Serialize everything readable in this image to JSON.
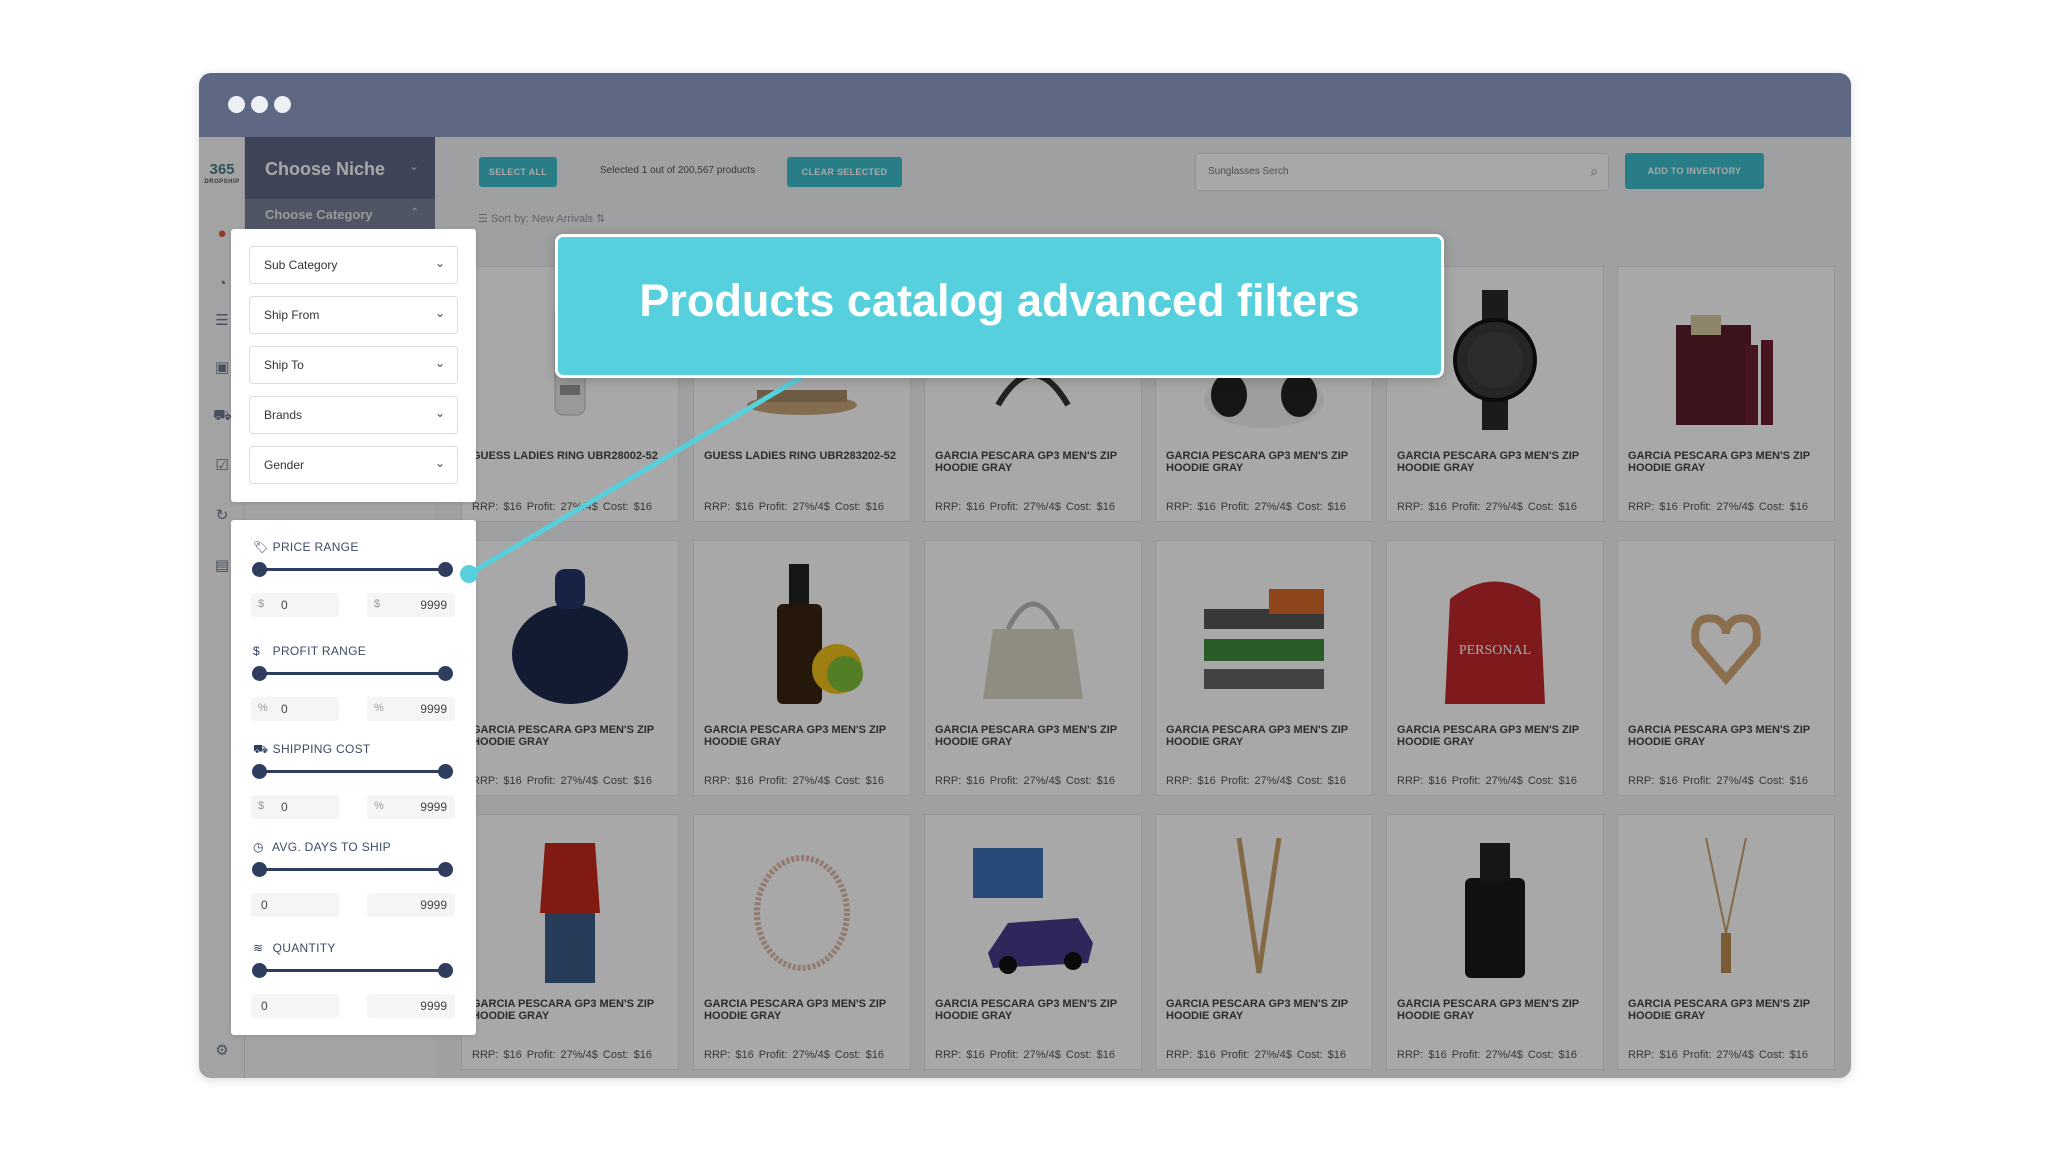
{
  "window": {
    "title_dots": 3
  },
  "logo": {
    "main": "365",
    "sub": "DROPSHIP"
  },
  "sidebar": {
    "niche_label": "Choose Niche",
    "category_label": "Choose Category",
    "dropdowns": [
      "Sub Category",
      "Ship From",
      "Ship To",
      "Brands",
      "Gender"
    ],
    "ranges": [
      {
        "label": "PRICE RANGE",
        "icon": "price-tag-icon",
        "min_symbol": "$",
        "min": "0",
        "max_symbol": "$",
        "max": "9999"
      },
      {
        "label": "PROFIT RANGE",
        "icon": "dollar-circle-icon",
        "min_symbol": "%",
        "min": "0",
        "max_symbol": "%",
        "max": "9999"
      },
      {
        "label": "SHIPPING COST",
        "icon": "truck-icon",
        "min_symbol": "$",
        "min": "0",
        "max_symbol": "%",
        "max": "9999"
      },
      {
        "label": "AVG. DAYS TO SHIP",
        "icon": "clock-icon",
        "min_symbol": "",
        "min": "0",
        "max_symbol": "",
        "max": "9999"
      },
      {
        "label": "QUANTITY",
        "icon": "layers-icon",
        "min_symbol": "",
        "min": "0",
        "max_symbol": "",
        "max": "9999"
      }
    ]
  },
  "toolbar": {
    "select_all": "SELECT ALL",
    "selected_text": "Selected  1 out of 200,567 products",
    "clear_selected": "CLEAR SELECTED",
    "search_value": "Sunglasses Serch",
    "add_to_inventory": "ADD TO INVENTORY",
    "sort_label": "Sort by: New Arrivals"
  },
  "products": [
    {
      "title": "GUESS LADIES RING UBR28002-52",
      "meta": "RRP: $16  Profit: 27%/4$  Cost: $16",
      "img": "perfume"
    },
    {
      "title": "GUESS LADIES RING UBR283202-52",
      "meta": "RRP: $16  Profit: 27%/4$  Cost: $16",
      "img": "ring"
    },
    {
      "title": "GARCIA PESCARA GP3 MEN'S ZIP HOODIE GRAY",
      "meta": "RRP: $16  Profit: 27%/4$  Cost: $16",
      "img": "headphones"
    },
    {
      "title": "GARCIA PESCARA GP3 MEN'S ZIP HOODIE GRAY",
      "meta": "RRP: $16  Profit: 27%/4$  Cost: $16",
      "img": "panda"
    },
    {
      "title": "GARCIA PESCARA GP3 MEN'S ZIP HOODIE GRAY",
      "meta": "RRP: $16  Profit: 27%/4$  Cost: $16",
      "img": "watch"
    },
    {
      "title": "GARCIA PESCARA GP3 MEN'S ZIP HOODIE GRAY",
      "meta": "RRP: $16  Profit: 27%/4$  Cost: $16",
      "img": "gift-box"
    },
    {
      "title": "GARCIA PESCARA GP3 MEN'S ZIP HOODIE GRAY",
      "meta": "RRP: $16  Profit: 27%/4$  Cost: $16",
      "img": "perfume-bottle"
    },
    {
      "title": "GARCIA PESCARA GP3 MEN'S ZIP HOODIE GRAY",
      "meta": "RRP: $16  Profit: 27%/4$  Cost: $16",
      "img": "oil-bottle"
    },
    {
      "title": "GARCIA PESCARA GP3 MEN'S ZIP HOODIE GRAY",
      "meta": "RRP: $16  Profit: 27%/4$  Cost: $16",
      "img": "handbag"
    },
    {
      "title": "GARCIA PESCARA GP3 MEN'S ZIP HOODIE GRAY",
      "meta": "RRP: $16  Profit: 27%/4$  Cost: $16",
      "img": "toy-train"
    },
    {
      "title": "GARCIA PESCARA GP3 MEN'S ZIP HOODIE GRAY",
      "meta": "RRP: $16  Profit: 27%/4$  Cost: $16",
      "img": "red-hoodie"
    },
    {
      "title": "GARCIA PESCARA GP3 MEN'S ZIP HOODIE GRAY",
      "meta": "RRP: $16  Profit: 27%/4$  Cost: $16",
      "img": "heart-ring"
    },
    {
      "title": "GARCIA PESCARA GP3 MEN'S ZIP HOODIE GRAY",
      "meta": "RRP: $16  Profit: 27%/4$  Cost: $16",
      "img": "red-top"
    },
    {
      "title": "GARCIA PESCARA GP3 MEN'S ZIP HOODIE GRAY",
      "meta": "RRP: $16  Profit: 27%/4$  Cost: $16",
      "img": "bracelet"
    },
    {
      "title": "GARCIA PESCARA GP3 MEN'S ZIP HOODIE GRAY",
      "meta": "RRP: $16  Profit: 27%/4$  Cost: $16",
      "img": "toy-car"
    },
    {
      "title": "GARCIA PESCARA GP3 MEN'S ZIP HOODIE GRAY",
      "meta": "RRP: $16  Profit: 27%/4$  Cost: $16",
      "img": "necklace"
    },
    {
      "title": "GARCIA PESCARA GP3 MEN'S ZIP HOODIE GRAY",
      "meta": "RRP: $16  Profit: 27%/4$  Cost: $16",
      "img": "cologne"
    },
    {
      "title": "GARCIA PESCARA GP3 MEN'S ZIP HOODIE GRAY",
      "meta": "RRP: $16  Profit: 27%/4$  Cost: $16",
      "img": "pendant"
    }
  ],
  "callout": {
    "text": "Products catalog advanced filters"
  },
  "colors": {
    "accent": "#3dbecd",
    "header": "#5e6883",
    "callout": "#55d0dc",
    "slider": "#2f3d5e"
  }
}
